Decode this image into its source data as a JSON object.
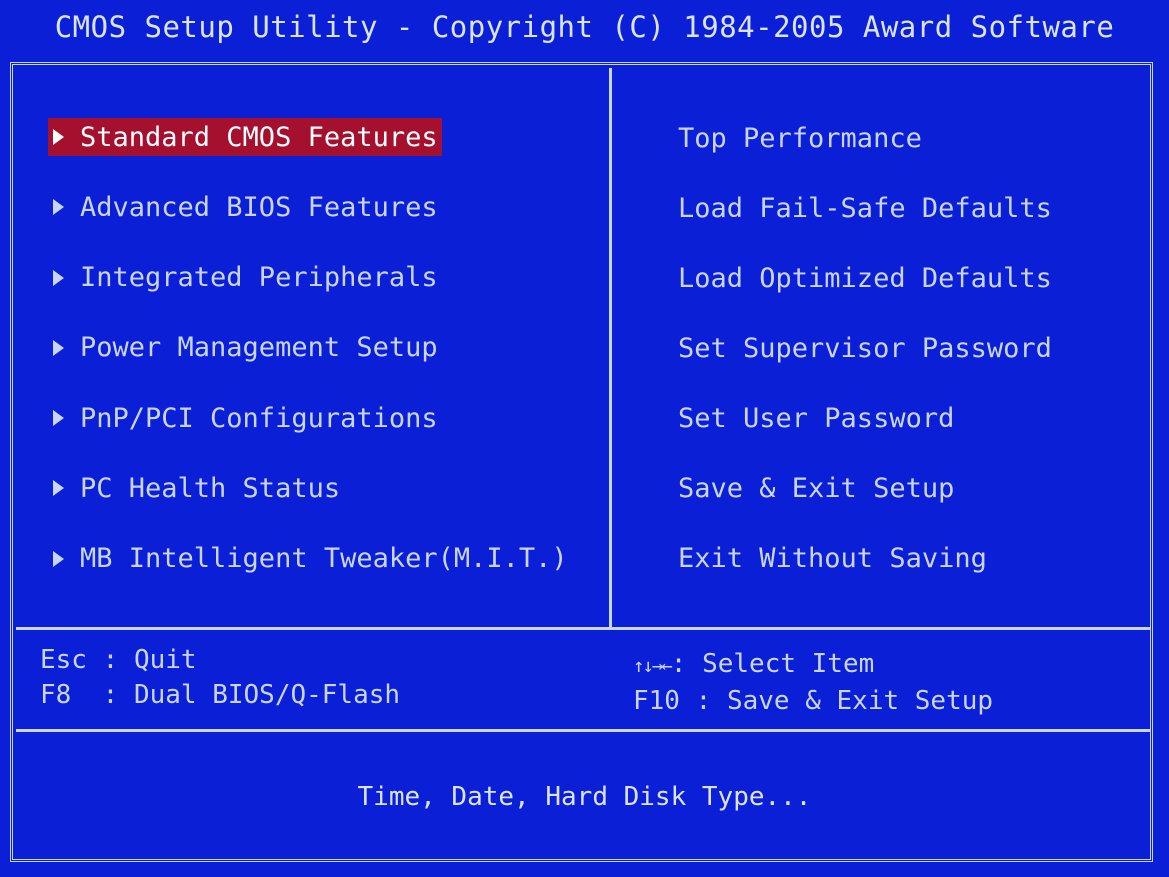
{
  "header": {
    "title": "CMOS Setup Utility - Copyright (C) 1984-2005 Award Software"
  },
  "left_menu": {
    "items": [
      {
        "label": "Standard CMOS Features",
        "selected": true
      },
      {
        "label": "Advanced BIOS Features",
        "selected": false
      },
      {
        "label": "Integrated Peripherals",
        "selected": false
      },
      {
        "label": "Power Management Setup",
        "selected": false
      },
      {
        "label": "PnP/PCI Configurations",
        "selected": false
      },
      {
        "label": "PC Health Status",
        "selected": false
      },
      {
        "label": "MB Intelligent Tweaker(M.I.T.)",
        "selected": false
      }
    ]
  },
  "right_menu": {
    "items": [
      {
        "label": "Top Performance"
      },
      {
        "label": "Load Fail-Safe Defaults"
      },
      {
        "label": "Load Optimized Defaults"
      },
      {
        "label": "Set Supervisor Password"
      },
      {
        "label": "Set User Password"
      },
      {
        "label": "Save & Exit Setup"
      },
      {
        "label": "Exit Without Saving"
      }
    ]
  },
  "key_hints": {
    "left": [
      {
        "key": "Esc",
        "sep": " : ",
        "action": "Quit"
      },
      {
        "key": "F8 ",
        "sep": " : ",
        "action": "Dual BIOS/Q-Flash"
      }
    ],
    "right": [
      {
        "key": "↑↓→←",
        "sep": ": ",
        "action": "Select Item"
      },
      {
        "key": "F10",
        "sep": " : ",
        "action": "Save & Exit Setup"
      }
    ]
  },
  "help_text": "Time, Date, Hard Disk Type...",
  "colors": {
    "background": "#0b1fd6",
    "text": "#c8d6ff",
    "highlight": "#a4102e",
    "highlight_text": "#ffffff"
  }
}
